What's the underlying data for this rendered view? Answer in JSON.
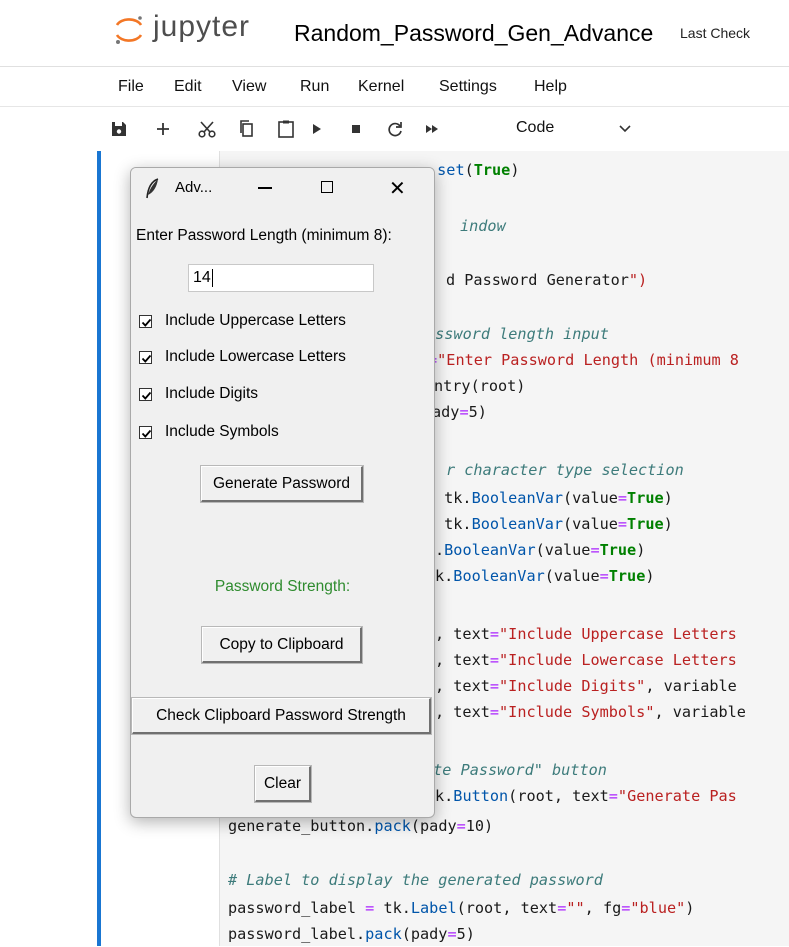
{
  "app": {
    "logo_text": "jupyter",
    "notebook_title": "Random_Password_Gen_Advance",
    "last_checkpoint": "Last Check",
    "brand_color": "#f37726"
  },
  "menu": [
    "File",
    "Edit",
    "View",
    "Run",
    "Kernel",
    "Settings",
    "Help"
  ],
  "toolbar": {
    "icons": [
      "save-icon",
      "add-cell-icon",
      "cut-icon",
      "copy-icon",
      "paste-icon",
      "run-icon",
      "stop-icon",
      "restart-icon",
      "run-all-icon"
    ],
    "cell_type": "Code"
  },
  "code_lines": [
    ".set(True)",
    "indow",
    "d Password Generator\")",
    "assword length input",
    "=\"Enter Password Length (minimum 8",
    "ntry(root)",
    "ady=5)",
    "r character type selection",
    " tk.BooleanVar(value=True)",
    " tk.BooleanVar(value=True)",
    ".BooleanVar(value=True)",
    "k.BooleanVar(value=True)",
    ", text=\"Include Uppercase Letters",
    ", text=\"Include Lowercase Letters",
    ", text=\"Include Digits\", variable",
    ", text=\"Include Symbols\", variable",
    "ate Password\" button",
    "k.Button(root, text=\"Generate Pas",
    "generate_button.pack(pady=10)",
    "# Label to display the generated password",
    "password_label = tk.Label(root, text=\"\", fg=\"blue\")",
    "password_label.pack(pady=5)"
  ],
  "tk_window": {
    "title": "Adv...",
    "length_label": "Enter Password Length (minimum 8):",
    "length_value": "14",
    "checkboxes": [
      {
        "label": "Include Uppercase Letters",
        "checked": true
      },
      {
        "label": "Include Lowercase Letters",
        "checked": true
      },
      {
        "label": "Include Digits",
        "checked": true
      },
      {
        "label": "Include Symbols",
        "checked": true
      }
    ],
    "generate_button": "Generate Password",
    "strength_label": "Password Strength:",
    "strength_color": "#2e8b2e",
    "copy_button": "Copy to Clipboard",
    "check_button": "Check Clipboard Password Strength",
    "clear_button": "Clear"
  }
}
